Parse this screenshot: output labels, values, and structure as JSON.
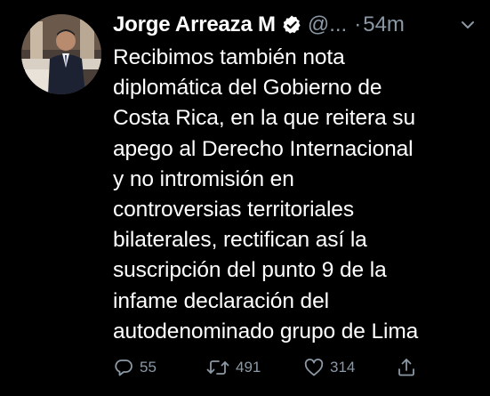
{
  "tweet": {
    "author_name": "Jorge Arreaza M",
    "handle": "@...",
    "separator": "·",
    "time": "54m",
    "lines": [
      "Recibimos también nota",
      "diplomática del Gobierno de",
      "Costa Rica, en la que reitera su",
      "apego al Derecho Internacional",
      "y no intromisión en",
      "controversias territoriales",
      "bilaterales, rectifican así la",
      "suscripción del punto 9 de la",
      "infame declaración del",
      "autodenominado grupo de Lima"
    ],
    "reply_count": "55",
    "retweet_count": "491",
    "like_count": "314"
  },
  "colors": {
    "background": "#000000",
    "text": "#ffffff",
    "secondary": "#8b98a5",
    "verified": "#ffffff"
  },
  "icons": {
    "verified": "verified-badge-icon",
    "menu": "chevron-down-icon",
    "reply": "reply-icon",
    "retweet": "retweet-icon",
    "like": "heart-icon",
    "share": "share-icon"
  }
}
